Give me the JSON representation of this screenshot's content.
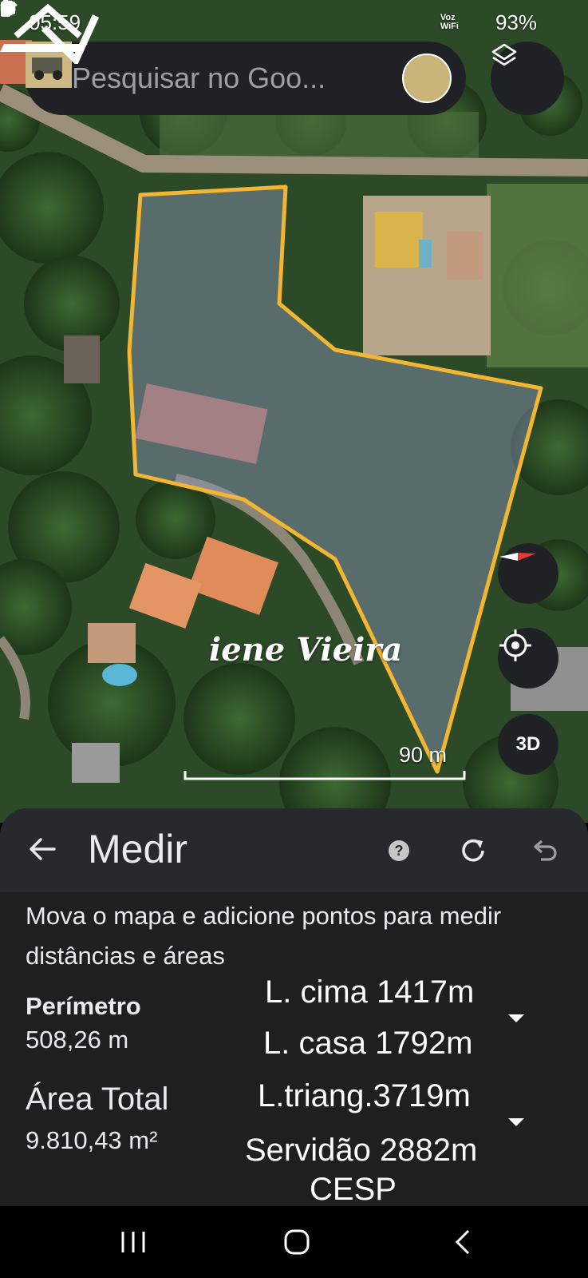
{
  "status_bar": {
    "time": "05:59",
    "battery": "93%",
    "wifi_label_top": "Voz",
    "wifi_label_bottom": "WiFi",
    "left_icons": [
      "image-icon",
      "chrome-icon",
      "instagram-icon",
      "dot-icon"
    ],
    "right_icons": [
      "alarm-icon",
      "mute-icon",
      "wifi-icon",
      "signal-icon",
      "battery-icon"
    ]
  },
  "search": {
    "placeholder": "Pesquisar no Goo..."
  },
  "map": {
    "scale_label": "90 m",
    "watermark": "iene Vieira",
    "buttons": {
      "three_d": "3D"
    },
    "outline_color": "#f2b632"
  },
  "panel": {
    "title": "Medir",
    "hint": "Mova o mapa e adicione pontos para medir distâncias e áreas",
    "perimeter_label": "Perímetro",
    "perimeter_value": "508,26 m",
    "area_label": "Área Total",
    "area_value": "9.810,43 m²",
    "notes": [
      "L. cima 1417m",
      "L. casa 1792m",
      "L.triang.3719m",
      "Servidão  2882m",
      "CESP"
    ]
  },
  "navbar": {
    "icons": [
      "recent-apps-icon",
      "home-icon",
      "back-icon"
    ]
  }
}
